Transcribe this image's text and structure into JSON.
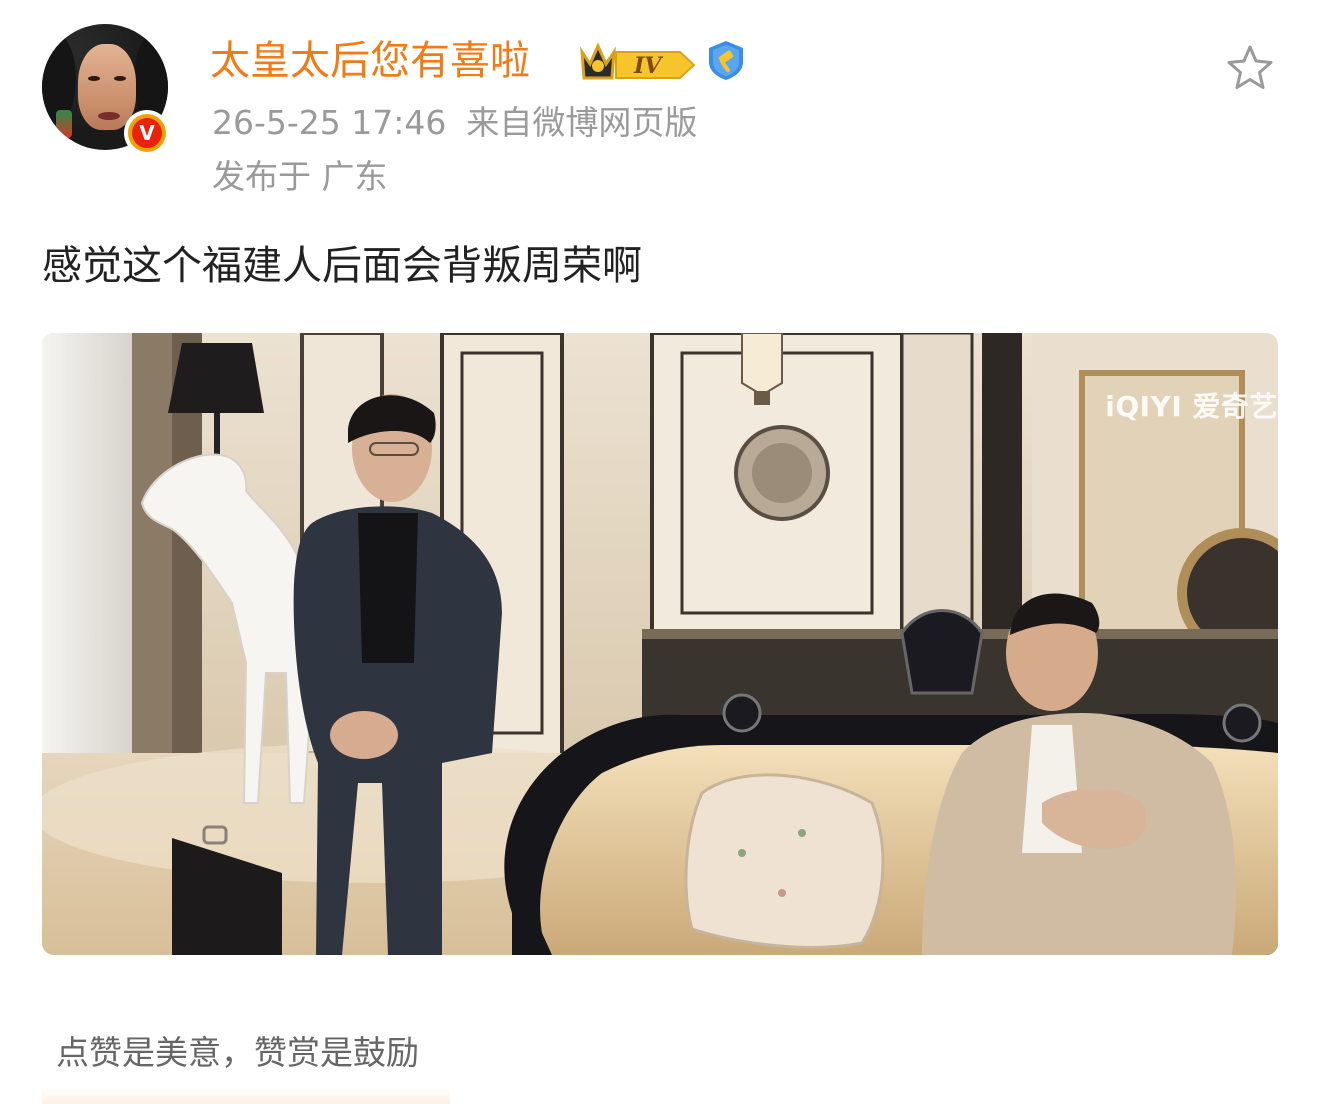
{
  "post": {
    "author": {
      "name": "太皇太后您有喜啦",
      "avatar_icon": "user-avatar",
      "verified_icon": "verified-v-icon",
      "level_badge": "IV",
      "level_icon": "crown-level-icon",
      "shield_icon": "shield-hammer-icon"
    },
    "timestamp": "26-5-25 17:46",
    "source": "来自微博网页版",
    "location": "发布于 广东",
    "text": "感觉这个福建人后面会背叛周荣啊",
    "image": {
      "watermark": "iQIYI 爱奇艺"
    },
    "favorite_icon": "star-icon"
  },
  "footer": {
    "tip": "点赞是美意，赞赏是鼓励"
  },
  "colors": {
    "username": "#f17b16",
    "meta": "#9a9a9a",
    "text": "#222222",
    "verified_outer": "#f2a102",
    "verified_inner": "#e8220c",
    "shield": "#3a8ee6"
  }
}
